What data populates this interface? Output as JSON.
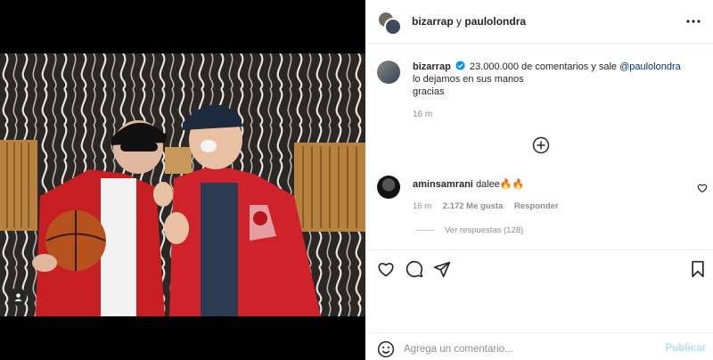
{
  "post": {
    "header": {
      "user1": "bizarrap",
      "separator": "y",
      "user2": "paulolondra"
    },
    "caption": {
      "username": "bizarrap",
      "text_part1": "23.000.000 de comentarios y sale",
      "mention": "@paulolondra",
      "line2": "lo dejamos en sus manos",
      "line3": "gracias",
      "time": "16 m"
    },
    "comment": {
      "username": "aminsamrani",
      "text": "dalee🔥🔥",
      "time": "16 m",
      "likes": "2.172 Me gusta",
      "reply_label": "Responder",
      "view_replies": "Ver respuestas (128)"
    },
    "add_comment": {
      "placeholder": "Agrega un comentario...",
      "publish_label": "Publicar"
    },
    "icons": {
      "more": "more-options-icon",
      "load_more": "plus-circle-icon",
      "like": "heart-icon",
      "comment": "comment-bubble-icon",
      "share": "paper-plane-icon",
      "save": "bookmark-icon",
      "emoji": "smiley-icon",
      "tag": "person-tag-icon",
      "verified": "verified-badge-icon"
    },
    "colors": {
      "mention": "#00376b",
      "verified": "#0095f6",
      "publish_disabled": "#b2dffc",
      "meta": "#8e8e8e"
    }
  }
}
